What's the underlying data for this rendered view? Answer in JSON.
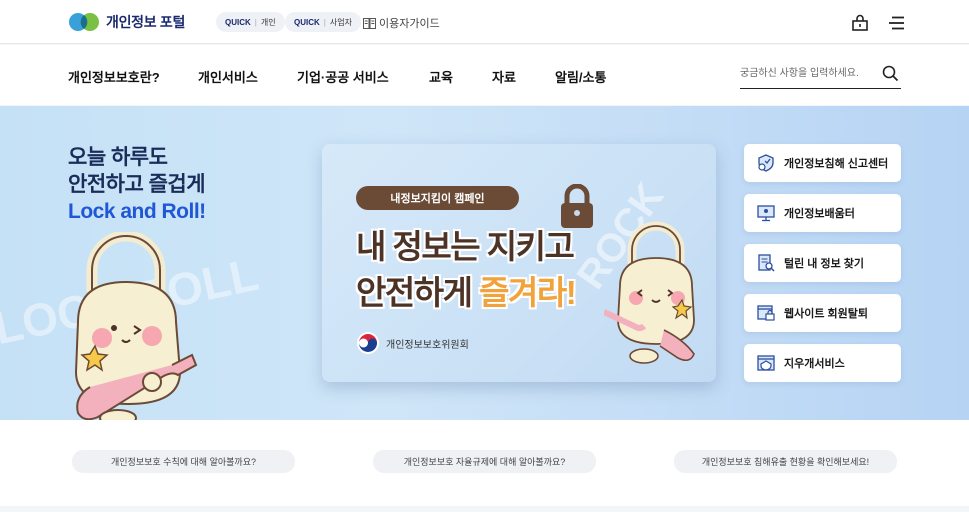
{
  "header": {
    "logo_text": "개인정보 포털",
    "quick_personal": {
      "tag": "QUICK",
      "label": "개인"
    },
    "quick_business": {
      "tag": "QUICK",
      "label": "사업자"
    },
    "user_guide": "이용자가이드"
  },
  "nav": {
    "items": [
      "개인정보보호란?",
      "개인서비스",
      "기업·공공 서비스",
      "교육",
      "자료",
      "알림/소통"
    ],
    "search_placeholder": "궁금하신 사항을 입력하세요."
  },
  "hero": {
    "slogan_line1": "오늘 하루도",
    "slogan_line2": "안전하고 즐겁게",
    "slogan_line3": "Lock and Roll!",
    "bg_text_left": "LOCK ROLL",
    "banner": {
      "pill": "내정보지킴이 캠페인",
      "line1_a": "내 정보는 ",
      "line1_b": "지키고",
      "line2_a": "안전하게 ",
      "line2_b": "즐겨라!",
      "org": "개인정보보호위원회"
    }
  },
  "quick_menu": [
    {
      "label": "개인정보침해 신고센터",
      "icon": "shield-report-icon"
    },
    {
      "label": "개인정보배움터",
      "icon": "monitor-learn-icon"
    },
    {
      "label": "털린 내 정보 찾기",
      "icon": "document-search-icon"
    },
    {
      "label": "웹사이트 회원탈퇴",
      "icon": "browser-lock-icon"
    },
    {
      "label": "지우개서비스",
      "icon": "browser-erase-icon"
    }
  ],
  "bottom_links": [
    "개인정보보호 수칙에 대해 알아볼까요?",
    "개인정보보호 자율규제에 대해 알아볼까요?",
    "개인정보보호 침해유출 현황을 확인해보세요!"
  ],
  "colors": {
    "brand": "#1b2a6e",
    "accent_blue": "#1f57d6",
    "hero_bg": "#c5e1f6",
    "banner_brown": "#4d3326",
    "banner_orange": "#f2a23a"
  }
}
